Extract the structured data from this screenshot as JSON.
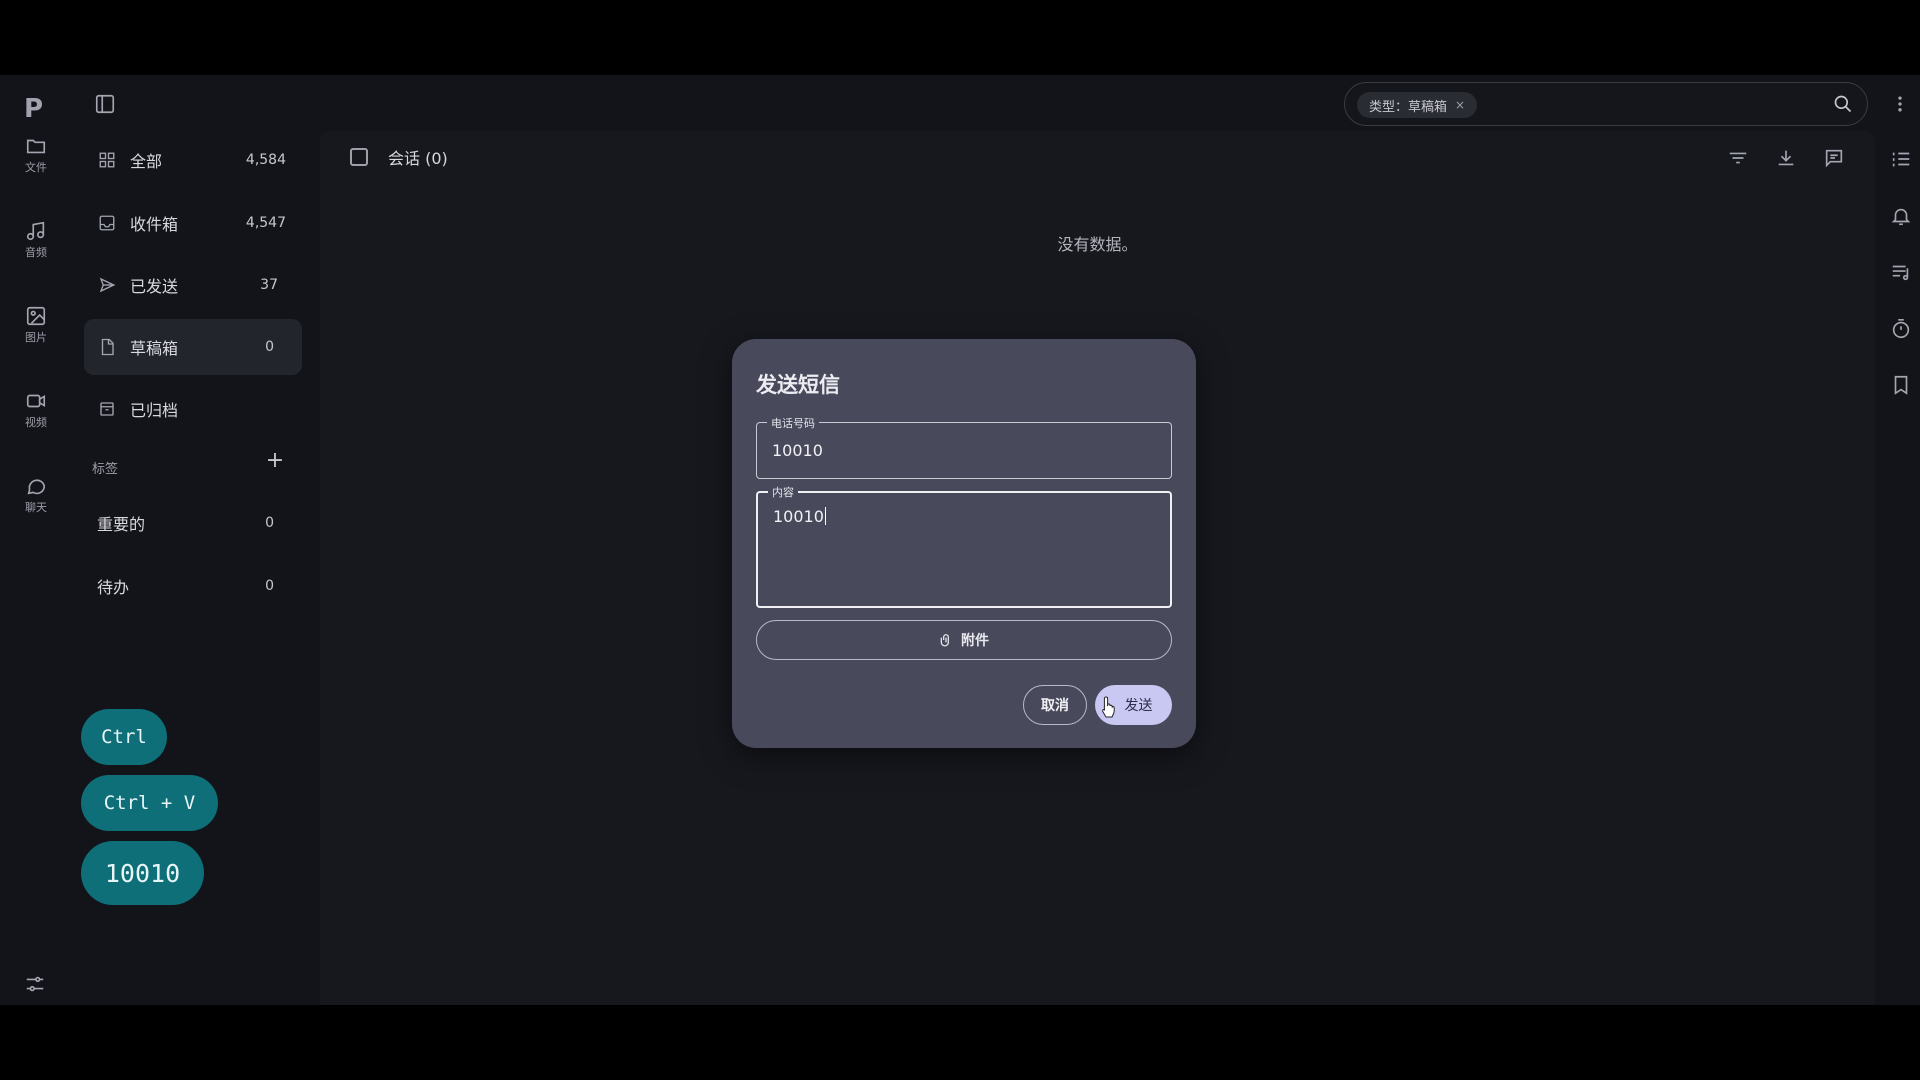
{
  "rail": {
    "logo": "P",
    "items": [
      {
        "label": "文件",
        "icon": "folder-icon"
      },
      {
        "label": "音频",
        "icon": "music-icon"
      },
      {
        "label": "图片",
        "icon": "image-icon"
      },
      {
        "label": "视频",
        "icon": "video-icon"
      },
      {
        "label": "聊天",
        "icon": "chat-icon"
      }
    ]
  },
  "nav": {
    "items": [
      {
        "label": "全部",
        "count": "4,584"
      },
      {
        "label": "收件箱",
        "count": "4,547"
      },
      {
        "label": "已发送",
        "count": "37"
      },
      {
        "label": "草稿箱",
        "count": "0"
      },
      {
        "label": "已归档",
        "count": ""
      }
    ],
    "tags_label": "标签",
    "tags_add": "+",
    "tags": [
      {
        "label": "重要的",
        "count": "0"
      },
      {
        "label": "待办",
        "count": "0"
      }
    ]
  },
  "keys": [
    "Ctrl",
    "Ctrl + V",
    "10010"
  ],
  "search": {
    "chip": "类型：草稿箱",
    "chip_close": "×"
  },
  "main": {
    "title": "会话 (0)",
    "empty": "没有数据。"
  },
  "dialog": {
    "title": "发送短信",
    "phone_label": "电话号码",
    "phone_value": "10010",
    "content_label": "内容",
    "content_value": "10010",
    "attach_label": "附件",
    "cancel_label": "取消",
    "send_label": "发送"
  }
}
